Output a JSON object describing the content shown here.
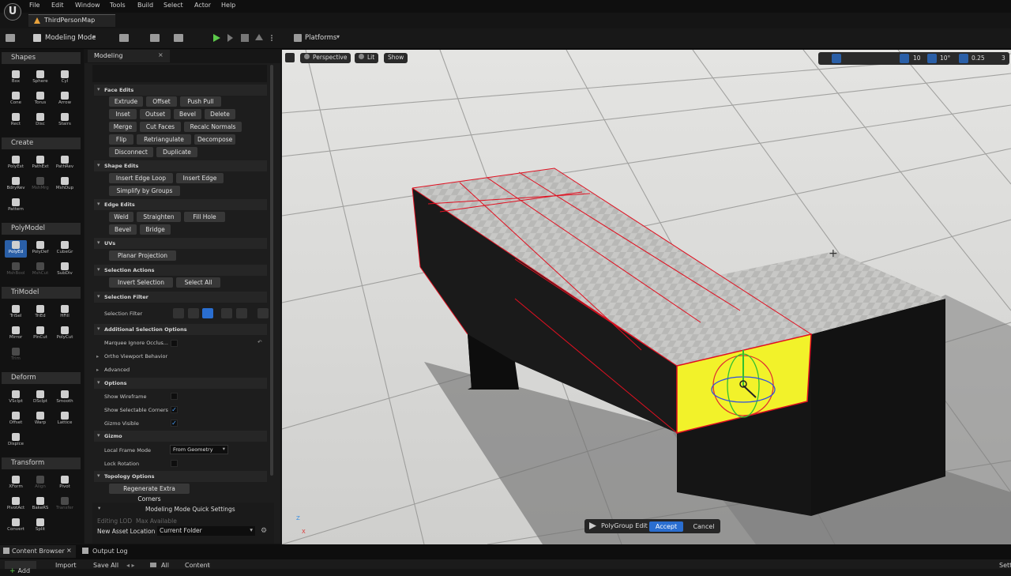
{
  "menubar": {
    "items": [
      "File",
      "Edit",
      "Window",
      "Tools",
      "Build",
      "Select",
      "Actor",
      "Help"
    ]
  },
  "map_tab": "ThirdPersonMap",
  "toolbar": {
    "mode": "Modeling Mode",
    "platforms": "Platforms"
  },
  "palette": {
    "categories": [
      {
        "name": "Shapes",
        "tools": [
          {
            "l": "Box"
          },
          {
            "l": "Sphere"
          },
          {
            "l": "Cyl"
          },
          {
            "l": "Cone"
          },
          {
            "l": "Torus"
          },
          {
            "l": "Arrow"
          },
          {
            "l": "Rect"
          },
          {
            "l": "Disc"
          },
          {
            "l": "Stairs"
          }
        ]
      },
      {
        "name": "Create",
        "tools": [
          {
            "l": "PolyExt"
          },
          {
            "l": "PathExt"
          },
          {
            "l": "PathRev"
          },
          {
            "l": "BdryRev"
          },
          {
            "l": "MshMrg",
            "dim": true
          },
          {
            "l": "MshDup"
          },
          {
            "l": "Pattern"
          }
        ]
      },
      {
        "name": "PolyModel",
        "tools": [
          {
            "l": "PolyEd",
            "sel": true
          },
          {
            "l": "PolyDef"
          },
          {
            "l": "CubeGr"
          },
          {
            "l": "MshBool",
            "dim": true
          },
          {
            "l": "MshCut",
            "dim": true
          },
          {
            "l": "SubDiv"
          }
        ]
      },
      {
        "name": "TriModel",
        "tools": [
          {
            "l": "TriSel"
          },
          {
            "l": "TriEd"
          },
          {
            "l": "HFill"
          },
          {
            "l": "Mirror"
          },
          {
            "l": "PlnCut"
          },
          {
            "l": "PolyCut"
          },
          {
            "l": "Trim",
            "dim": true
          }
        ]
      },
      {
        "name": "Deform",
        "tools": [
          {
            "l": "VSclpt"
          },
          {
            "l": "DSclpt"
          },
          {
            "l": "Smooth"
          },
          {
            "l": "Offset"
          },
          {
            "l": "Warp"
          },
          {
            "l": "Lattice"
          },
          {
            "l": "Displce"
          }
        ]
      },
      {
        "name": "Transform",
        "tools": [
          {
            "l": "XForm"
          },
          {
            "l": "Align",
            "dim": true
          },
          {
            "l": "Pivot"
          },
          {
            "l": "PivotAct"
          },
          {
            "l": "BakeRS"
          },
          {
            "l": "Transfer",
            "dim": true
          },
          {
            "l": "Convert"
          },
          {
            "l": "Split"
          }
        ]
      }
    ]
  },
  "panel": {
    "tab": "Modeling",
    "face_edits": {
      "title": "Face Edits",
      "rows": [
        [
          "Extrude",
          "Offset",
          "Push Pull"
        ],
        [
          "Inset",
          "Outset",
          "Bevel",
          "Delete"
        ],
        [
          "Merge",
          "Cut Faces",
          "Recalc Normals"
        ],
        [
          "Flip",
          "Retriangulate",
          "Decompose"
        ],
        [
          "Disconnect",
          "Duplicate"
        ]
      ]
    },
    "shape_edits": {
      "title": "Shape Edits",
      "rows": [
        [
          "Insert Edge Loop",
          "Insert Edge"
        ],
        [
          "Simplify by Groups"
        ]
      ]
    },
    "edge_edits": {
      "title": "Edge Edits",
      "rows": [
        [
          "Weld",
          "Straighten",
          "Fill Hole"
        ],
        [
          "Bevel",
          "Bridge"
        ]
      ]
    },
    "uvs": {
      "title": "UVs",
      "rows": [
        [
          "Planar Projection"
        ]
      ]
    },
    "selection_actions": {
      "title": "Selection Actions",
      "rows": [
        [
          "Invert Selection",
          "Select All"
        ]
      ]
    },
    "selection_filter": {
      "title": "Selection Filter",
      "label": "Selection Filter"
    },
    "additional": {
      "title": "Additional Selection Options",
      "marquee": "Marquee Ignore Occlus...",
      "ortho": "Ortho Viewport Behavior",
      "advanced": "Advanced"
    },
    "options": {
      "title": "Options",
      "wireframe": "Show Wireframe",
      "corners": "Show Selectable Corners",
      "gizmo_visible": "Gizmo Visible"
    },
    "gizmo": {
      "title": "Gizmo",
      "frame_mode": "Local Frame Mode",
      "frame_value": "From Geometry",
      "lock": "Lock Rotation"
    },
    "topology": {
      "title": "Topology Options",
      "button": "Regenerate Extra Corners"
    },
    "quick": {
      "title": "Modeling Mode Quick Settings",
      "editing_lod": "Editing LOD",
      "editing_lod_value": "Max Available",
      "asset_loc": "New Asset Location",
      "asset_loc_value": "Current Folder"
    }
  },
  "viewport": {
    "perspective": "Perspective",
    "lit": "Lit",
    "show": "Show",
    "grid_snap": "10",
    "rot_snap": "10°",
    "scale_snap": "0.25",
    "cam_speed": "3",
    "axis_z": "Z",
    "axis_x": "X",
    "polygroup_edit": "PolyGroup Edit",
    "accept": "Accept",
    "cancel": "Cancel"
  },
  "bottom": {
    "content_browser": "Content Browser",
    "output_log": "Output Log",
    "add": "Add",
    "import": "Import",
    "save_all": "Save All",
    "path": [
      "All",
      "Content"
    ],
    "right": "Sett"
  },
  "colors": {
    "accent": "#2a5fa7",
    "selected_face": "#f4f42a",
    "edge_red": "#e01020"
  }
}
